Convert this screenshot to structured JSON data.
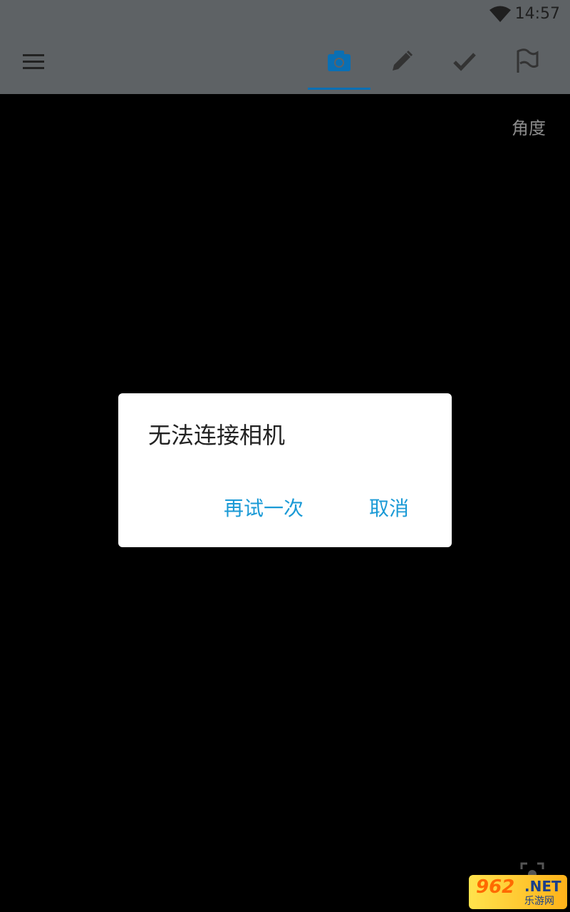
{
  "status_bar": {
    "time": "14:57",
    "wifi_icon": "wifi-icon"
  },
  "toolbar": {
    "menu_icon": "hamburger-menu-icon",
    "tabs": [
      {
        "icon": "camera-icon",
        "active": true
      },
      {
        "icon": "pencil-icon",
        "active": false
      },
      {
        "icon": "checkmark-icon",
        "active": false
      },
      {
        "icon": "flag-icon",
        "active": false
      }
    ],
    "accent_color": "#0a6fb4"
  },
  "viewfinder": {
    "angle_label": "角度"
  },
  "dialog": {
    "title": "无法连接相机",
    "retry_label": "再试一次",
    "cancel_label": "取消",
    "button_color": "#1a9ad6"
  },
  "watermark": {
    "number": "962",
    "net": ".NET",
    "sub": "乐游网"
  }
}
